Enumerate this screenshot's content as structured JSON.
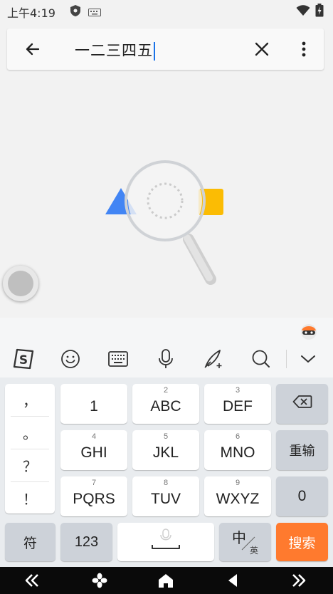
{
  "status_bar": {
    "time": "上午4:19"
  },
  "search": {
    "query": "一二三四五"
  },
  "keyboard": {
    "punctuation": [
      "，",
      "。",
      "？",
      "！"
    ],
    "rows": [
      [
        {
          "num": "",
          "label": "1"
        },
        {
          "num": "2",
          "label": "ABC"
        },
        {
          "num": "3",
          "label": "DEF"
        }
      ],
      [
        {
          "num": "4",
          "label": "GHI"
        },
        {
          "num": "5",
          "label": "JKL"
        },
        {
          "num": "6",
          "label": "MNO"
        }
      ],
      [
        {
          "num": "7",
          "label": "PQRS"
        },
        {
          "num": "8",
          "label": "TUV"
        },
        {
          "num": "9",
          "label": "WXYZ"
        }
      ]
    ],
    "reenter_label": "重输",
    "zero_label": "0",
    "symbols_label": "符",
    "numbers_label": "123",
    "lang_main": "中",
    "lang_sub": "英",
    "search_label": "搜索"
  },
  "colors": {
    "accent": "#1a73e8",
    "search_key": "#ff7a2e",
    "yellow": "#fbbc04"
  },
  "icons": [
    "back-arrow-icon",
    "clear-icon",
    "more-vert-icon",
    "sogou-logo-icon",
    "emoji-icon",
    "keyboard-icon",
    "mic-icon",
    "handwriting-icon",
    "search-icon",
    "collapse-icon",
    "backspace-icon",
    "nav-double-left-icon",
    "nav-apps-icon",
    "nav-home-icon",
    "nav-back-icon",
    "nav-double-right-icon"
  ]
}
